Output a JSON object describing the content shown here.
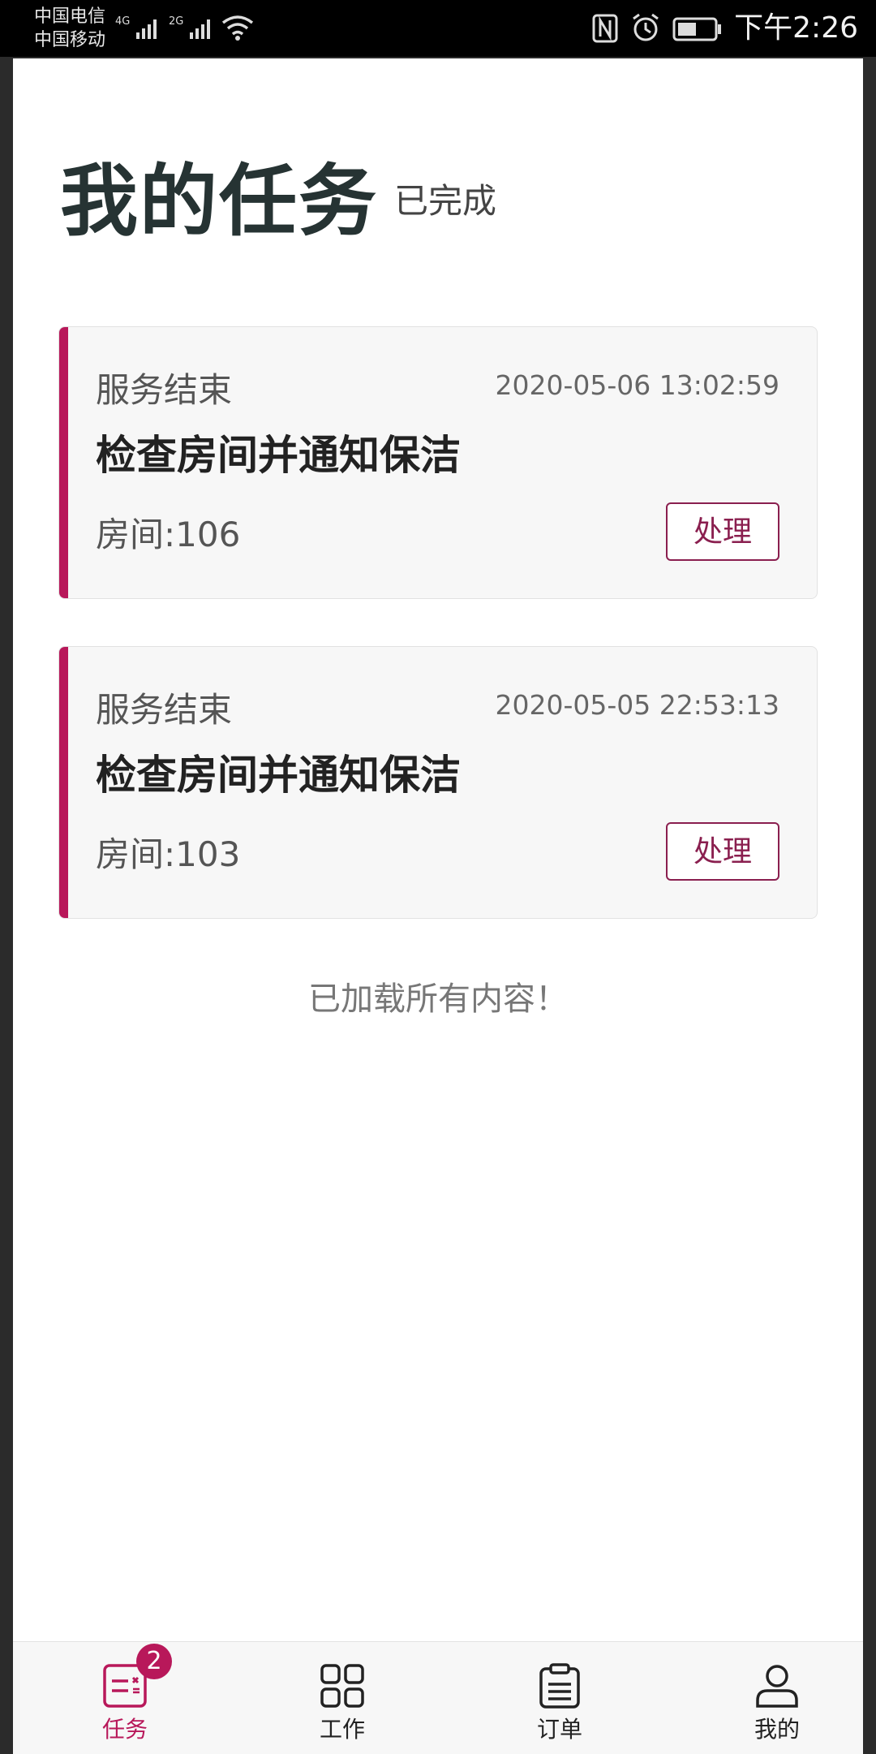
{
  "status_bar": {
    "carrier1": "中国电信",
    "carrier2": "中国移动",
    "net1": "4G",
    "net2": "2G",
    "time": "下午2:26"
  },
  "header": {
    "title": "我的任务",
    "tab": "已完成"
  },
  "tasks": [
    {
      "status": "服务结束",
      "time": "2020-05-06 13:02:59",
      "title": "检查房间并通知保洁",
      "room": "房间:106",
      "button": "处理"
    },
    {
      "status": "服务结束",
      "time": "2020-05-05 22:53:13",
      "title": "检查房间并通知保洁",
      "room": "房间:103",
      "button": "处理"
    }
  ],
  "load_message": "已加载所有内容！",
  "tabbar": {
    "items": [
      {
        "label": "任务",
        "icon": "task-list-icon",
        "badge": "2",
        "active": true
      },
      {
        "label": "工作",
        "icon": "grid-icon",
        "active": false
      },
      {
        "label": "订单",
        "icon": "clipboard-icon",
        "active": false
      },
      {
        "label": "我的",
        "icon": "user-icon",
        "active": false
      }
    ]
  },
  "colors": {
    "accent": "#b8185a",
    "title": "#263333"
  }
}
